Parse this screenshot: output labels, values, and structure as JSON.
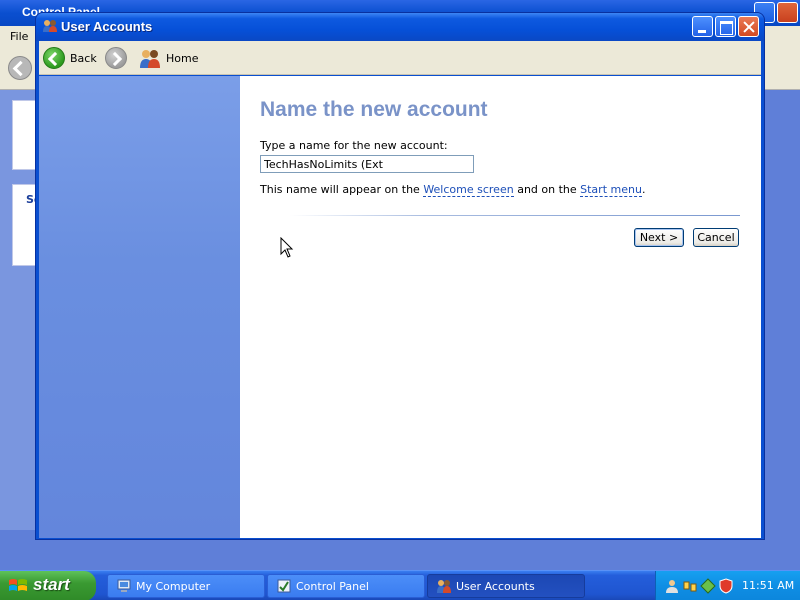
{
  "background_window": {
    "title": "Control Panel",
    "menu_file": "File",
    "card_label": "Se"
  },
  "window": {
    "title": "User Accounts"
  },
  "toolbar": {
    "back_label": "Back",
    "home_label": "Home"
  },
  "content": {
    "title": "Name the new account",
    "prompt": "Type a name for the new account:",
    "account_name_value": "TechHasNoLimits (Ext",
    "info_prefix": "This name will appear on the ",
    "welcome_link": "Welcome screen",
    "info_middle": " and on the ",
    "start_menu_link": "Start menu",
    "info_suffix": "."
  },
  "buttons": {
    "next": "Next >",
    "cancel": "Cancel"
  },
  "taskbar": {
    "start_label": "start",
    "items": [
      {
        "label": "My Computer"
      },
      {
        "label": "Control Panel"
      },
      {
        "label": "User Accounts"
      }
    ],
    "clock": "11:51 AM"
  },
  "icons": {
    "title": "user-accounts-icon",
    "back": "back-arrow-icon",
    "forward": "forward-arrow-icon",
    "home": "users-home-icon",
    "cursor": "mouse-pointer-icon"
  },
  "colors": {
    "title_bar": "#0650d8",
    "left_pane": "#6a8fe0",
    "heading": "#7a93c8",
    "link": "#1d4fb8",
    "taskbar": "#245edb",
    "start_button": "#3a9a32",
    "tray": "#0f8ee4"
  }
}
